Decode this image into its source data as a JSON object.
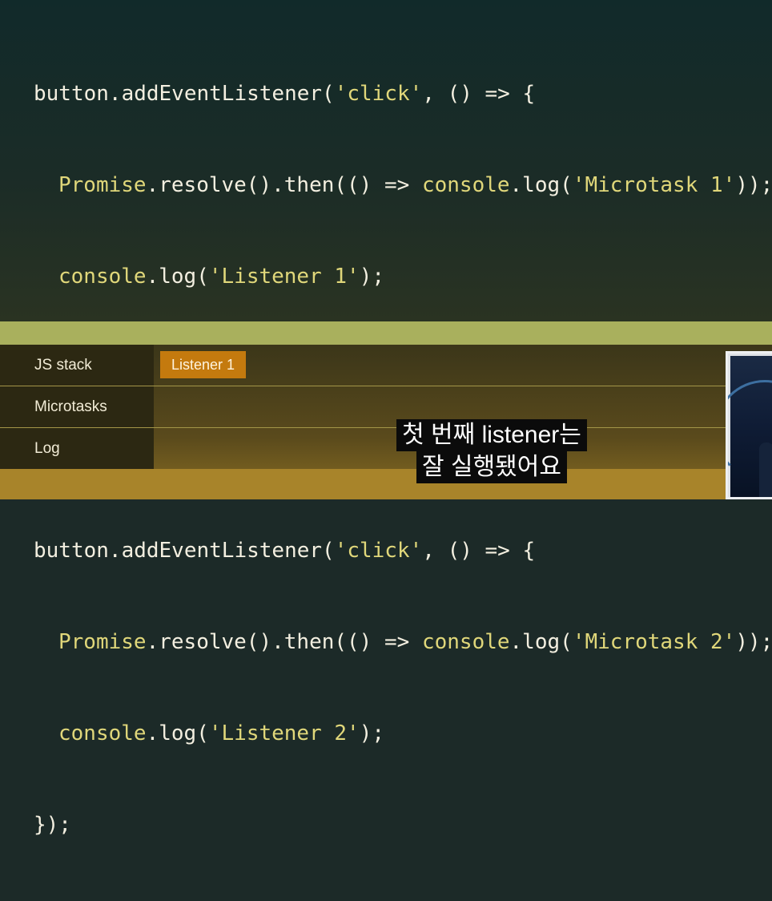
{
  "code": {
    "lines": [
      [
        "button.addEventListener(",
        "'click'",
        ", () => {"
      ],
      [
        "Promise",
        ".resolve().then(() => ",
        "console",
        ".log(",
        "'Microtask 1'",
        "));"
      ],
      [
        "console",
        ".log(",
        "'Listener 1'",
        ");"
      ],
      [
        "});"
      ],
      [
        "button.addEventListener(",
        "'click'",
        ", () => {"
      ],
      [
        "Promise",
        ".resolve().then(() => ",
        "console",
        ".log(",
        "'Microtask 2'",
        "));"
      ],
      [
        "console",
        ".log(",
        "'Listener 2'",
        ");"
      ],
      [
        "});"
      ]
    ]
  },
  "visualizer": {
    "rows": [
      {
        "label": "JS stack",
        "items": [
          "Listener 1"
        ]
      },
      {
        "label": "Microtasks",
        "items": []
      },
      {
        "label": "Log",
        "items": []
      }
    ]
  },
  "subtitle": {
    "line1": "첫 번째 listener는",
    "line2": "잘 실행됐어요"
  },
  "colors": {
    "keyword": "#e0d77a",
    "plain": "#f3efe0",
    "chip": "#c47a0e",
    "band": "#a9b05d"
  }
}
